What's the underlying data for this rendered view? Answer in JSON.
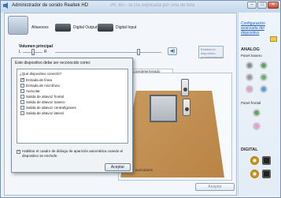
{
  "window": {
    "title": "Administrador de sonido Realtek HD",
    "title_ghost": "Ph. Bu - la cra explicada por una de Bita"
  },
  "device_tabs": [
    {
      "label": "Altavoces"
    },
    {
      "label": "Digital Output"
    },
    {
      "label": "Digital Input"
    }
  ],
  "volume": {
    "label": "Volumen principal",
    "left": "L",
    "right": "R",
    "set_default": "Establecer dispositivo predeterminado"
  },
  "formats_tab": "Formato predeterminado",
  "headphones_label": "auriculares",
  "dialog": {
    "title": "Este dispositivo debe ser reconocido como:",
    "question": "¿Qué dispositivo conectó?",
    "options": [
      {
        "label": "Entrada de línea",
        "checked": true
      },
      {
        "label": "Entrada de micrófono",
        "checked": false
      },
      {
        "label": "Auricular",
        "checked": false
      },
      {
        "label": "Salida de altavoz frontal",
        "checked": false
      },
      {
        "label": "Salida de altavoz trasero",
        "checked": false
      },
      {
        "label": "Salida de altavoz central/graves",
        "checked": false
      },
      {
        "label": "Salida de altavoz lateral",
        "checked": false
      }
    ],
    "auto_popup": {
      "label": "Habilitar el cuadro de diálogo de aparición automática cuando el dispositivo se enchufe.",
      "checked": true
    },
    "accept_label": "Aceptar"
  },
  "right_panel": {
    "config_link": "Configuración avanzada del dispositivo",
    "analog_title": "ANALOG",
    "rear_panel": "Panel trasero",
    "front_panel": "Panel frontal",
    "digital_title": "DIGITAL",
    "rear_jack_colors": [
      "#8a8f96",
      "#5fa55a",
      "#9a9a9a",
      "#6cb16a",
      "#ee9acb",
      "#5aa0d8"
    ],
    "front_jack_colors": [
      "#5fa55a",
      "#ee9acb"
    ]
  },
  "ok_label": "Aceptar"
}
